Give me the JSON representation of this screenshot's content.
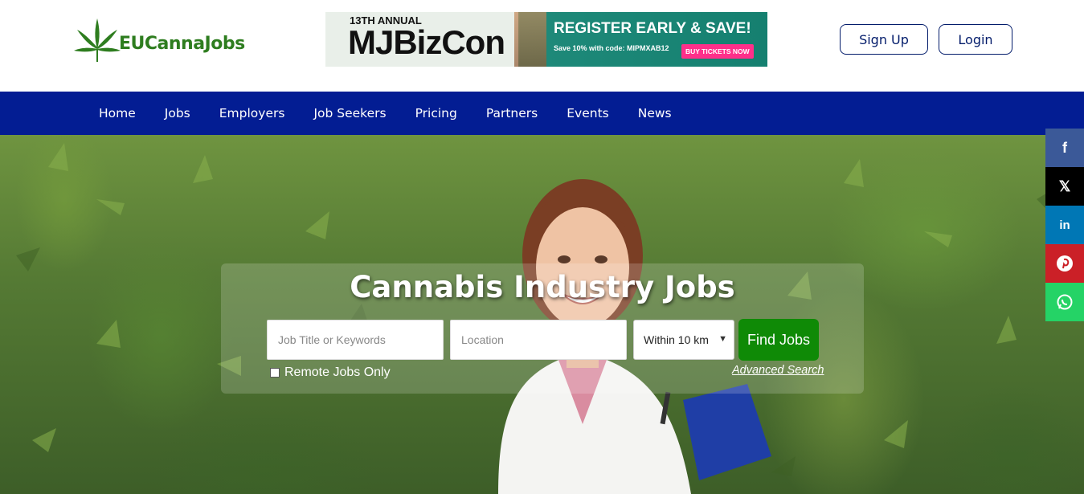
{
  "header": {
    "logo_text": "EUCannaJobs",
    "banner": {
      "annual": "13TH ANNUAL",
      "brand": "MJBizCon",
      "cta": "REGISTER EARLY & SAVE!",
      "code_text": "Save 10% with code: MIPMXAB12",
      "buy_label": "BUY TICKETS NOW"
    },
    "signup_label": "Sign Up",
    "login_label": "Login"
  },
  "nav": {
    "items": [
      "Home",
      "Jobs",
      "Employers",
      "Job Seekers",
      "Pricing",
      "Partners",
      "Events",
      "News"
    ]
  },
  "hero": {
    "title": "Cannabis Industry Jobs",
    "keywords_placeholder": "Job Title or Keywords",
    "location_placeholder": "Location",
    "radius_selected": "Within 10 km",
    "find_label": "Find Jobs",
    "remote_label": "Remote Jobs Only",
    "advanced_label": "Advanced Search"
  },
  "social": {
    "icons": [
      "facebook-icon",
      "x-icon",
      "linkedin-icon",
      "pinterest-icon",
      "whatsapp-icon"
    ],
    "facebook_glyph": "f",
    "x_glyph": "𝕏",
    "linkedin_glyph": "in"
  },
  "colors": {
    "brand_green": "#2e7d1f",
    "nav_blue": "#031d93",
    "button_green": "#0f8a06",
    "outline_navy": "#031c6b"
  }
}
